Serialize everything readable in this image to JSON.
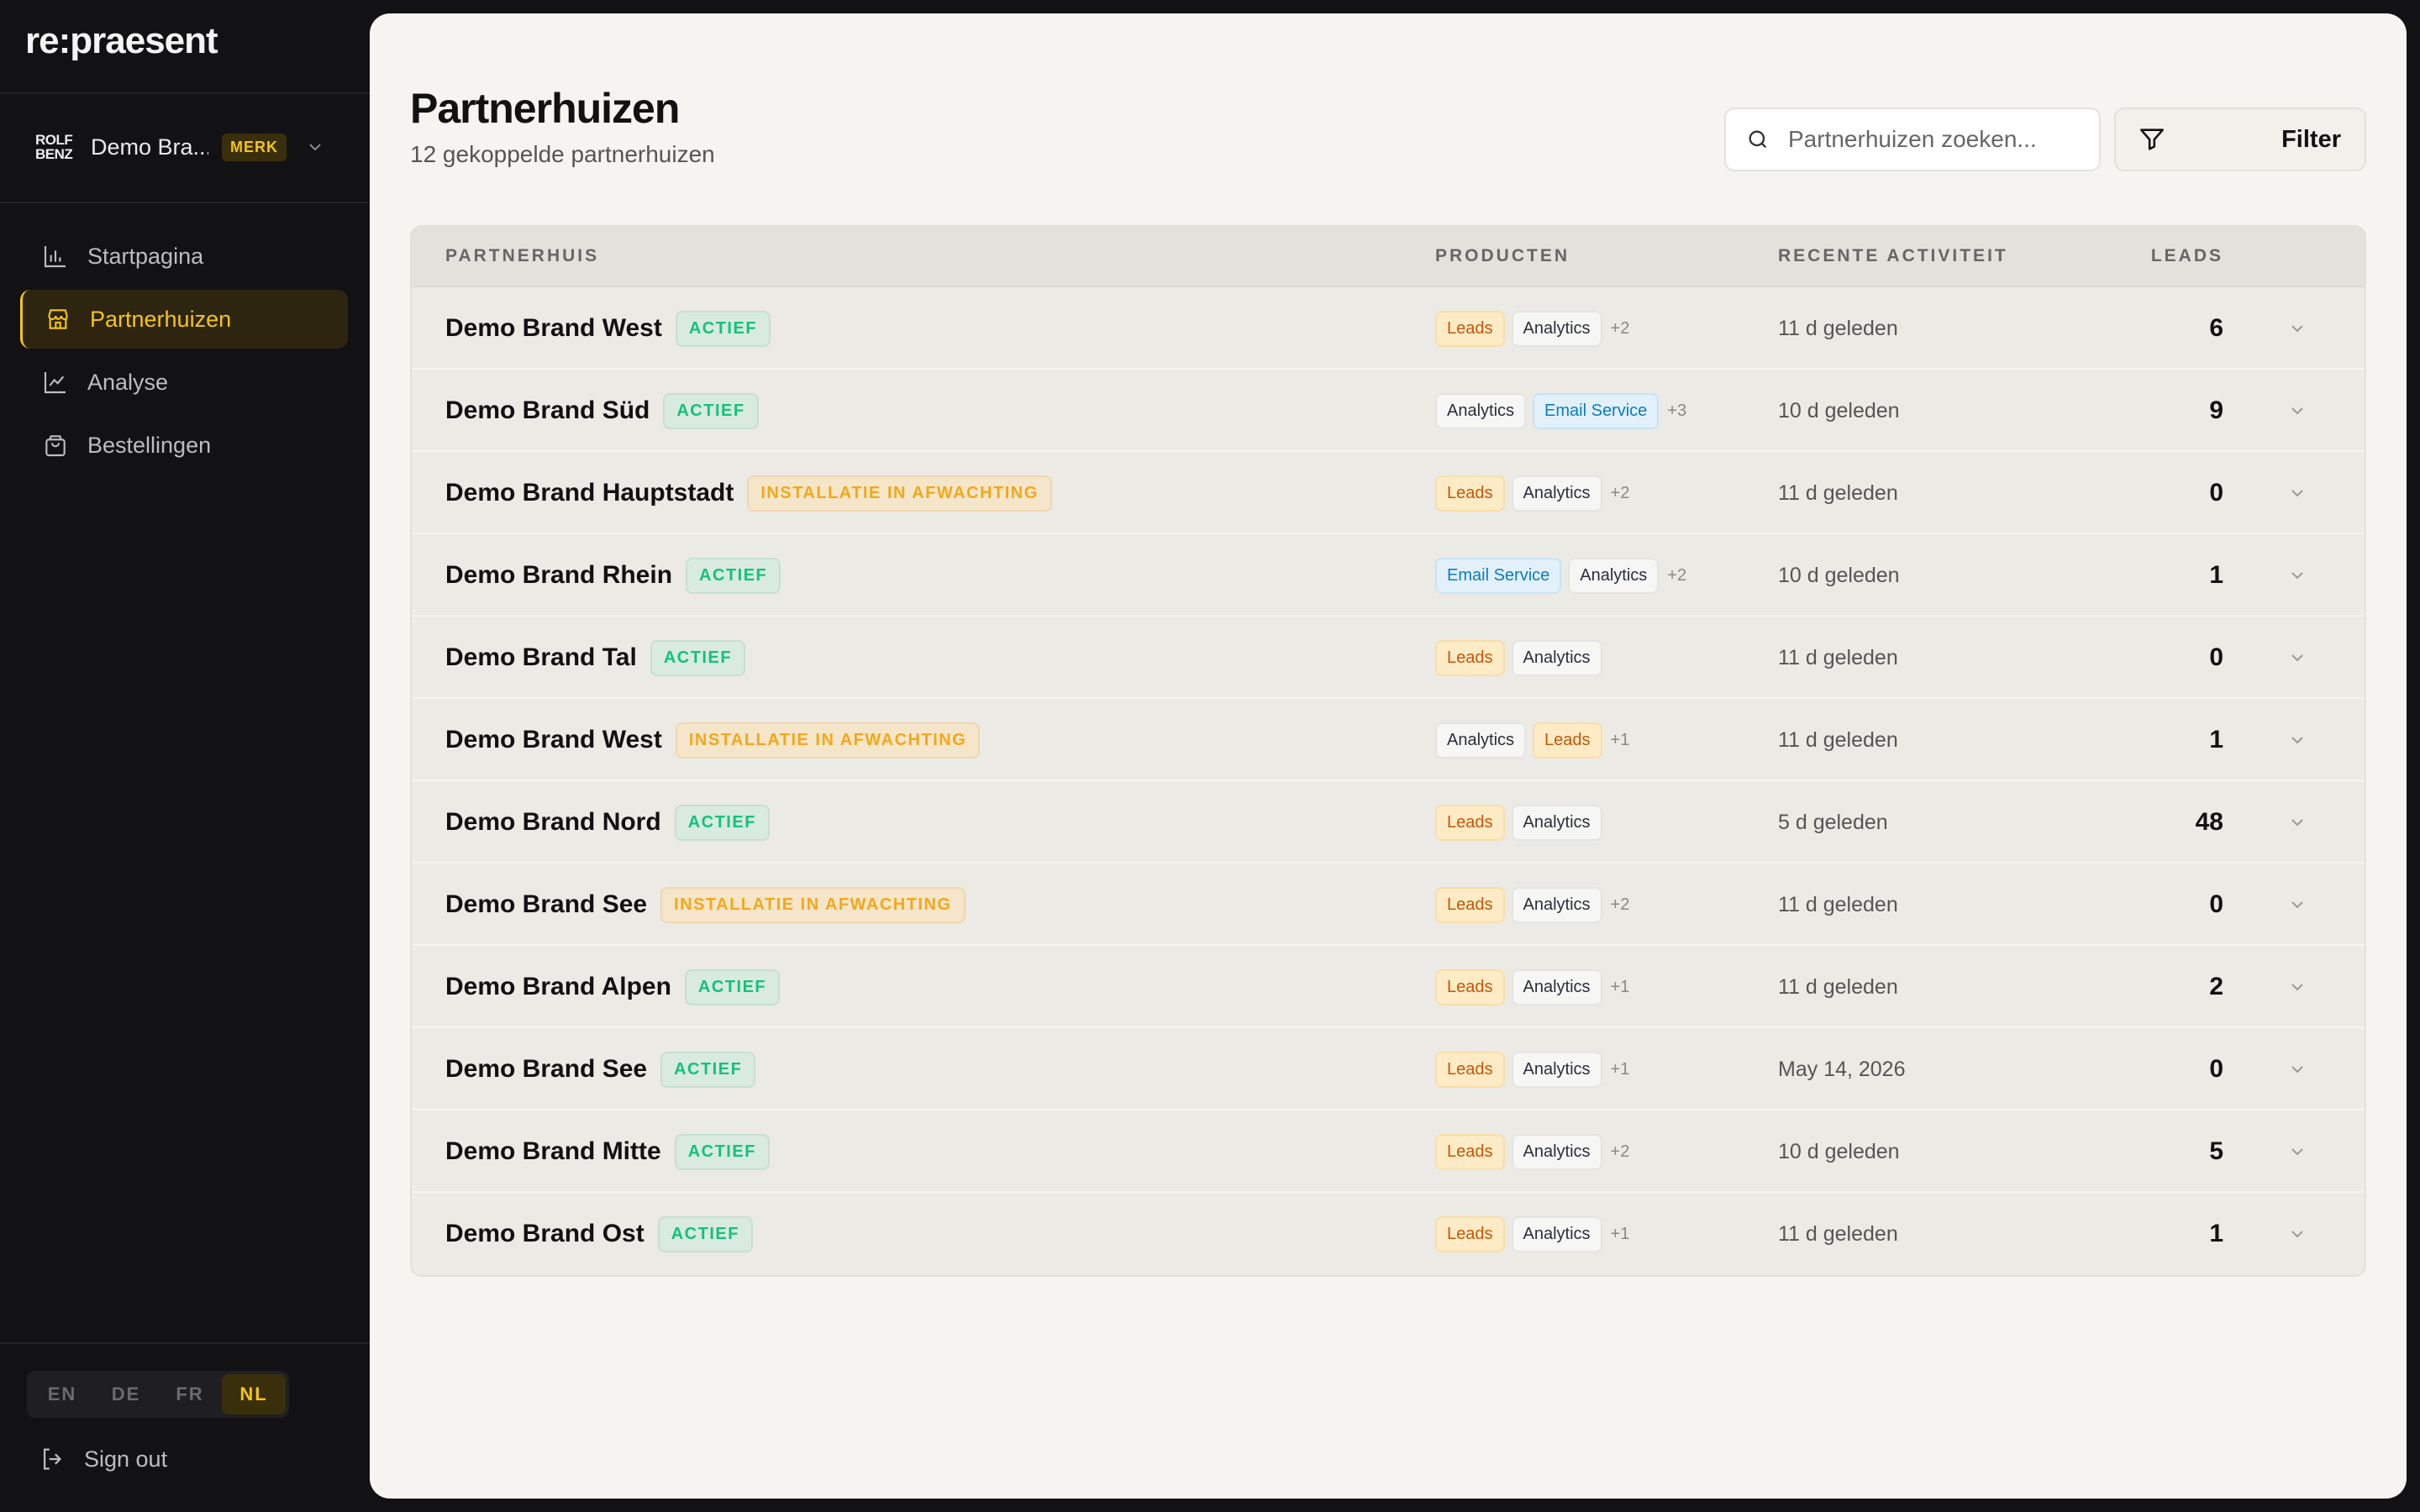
{
  "app": {
    "logo": "re:praesent"
  },
  "brand_switch": {
    "logo_line1": "ROLF",
    "logo_line2": "BENZ",
    "name": "Demo Bra...",
    "badge": "MERK"
  },
  "sidebar": {
    "items": [
      {
        "label": "Startpagina",
        "icon": "bar-chart-icon",
        "active": false
      },
      {
        "label": "Partnerhuizen",
        "icon": "store-icon",
        "active": true
      },
      {
        "label": "Analyse",
        "icon": "line-chart-icon",
        "active": false
      },
      {
        "label": "Bestellingen",
        "icon": "shopping-bag-icon",
        "active": false
      }
    ],
    "languages": [
      "EN",
      "DE",
      "FR",
      "NL"
    ],
    "active_language": "NL",
    "signout_label": "Sign out"
  },
  "main": {
    "title": "Partnerhuizen",
    "subtitle": "12 gekoppelde partnerhuizen",
    "search_placeholder": "Partnerhuizen zoeken...",
    "filter_label": "Filter"
  },
  "table": {
    "headers": {
      "partner": "PARTNERHUIS",
      "products": "PRODUCTEN",
      "activity": "RECENTE ACTIVITEIT",
      "leads": "LEADS"
    },
    "rows": [
      {
        "name": "Demo Brand West",
        "status": "ACTIEF",
        "status_type": "actief",
        "products": [
          {
            "label": "Leads",
            "type": "leads"
          },
          {
            "label": "Analytics",
            "type": "analytics"
          }
        ],
        "more": "+2",
        "activity": "11 d geleden",
        "leads": "6"
      },
      {
        "name": "Demo Brand Süd",
        "status": "ACTIEF",
        "status_type": "actief",
        "products": [
          {
            "label": "Analytics",
            "type": "analytics"
          },
          {
            "label": "Email Service",
            "type": "email"
          }
        ],
        "more": "+3",
        "activity": "10 d geleden",
        "leads": "9"
      },
      {
        "name": "Demo Brand Hauptstadt",
        "status": "INSTALLATIE IN AFWACHTING",
        "status_type": "pending",
        "products": [
          {
            "label": "Leads",
            "type": "leads"
          },
          {
            "label": "Analytics",
            "type": "analytics"
          }
        ],
        "more": "+2",
        "activity": "11 d geleden",
        "leads": "0"
      },
      {
        "name": "Demo Brand Rhein",
        "status": "ACTIEF",
        "status_type": "actief",
        "products": [
          {
            "label": "Email Service",
            "type": "email"
          },
          {
            "label": "Analytics",
            "type": "analytics"
          }
        ],
        "more": "+2",
        "activity": "10 d geleden",
        "leads": "1"
      },
      {
        "name": "Demo Brand Tal",
        "status": "ACTIEF",
        "status_type": "actief",
        "products": [
          {
            "label": "Leads",
            "type": "leads"
          },
          {
            "label": "Analytics",
            "type": "analytics"
          }
        ],
        "more": "",
        "activity": "11 d geleden",
        "leads": "0"
      },
      {
        "name": "Demo Brand West",
        "status": "INSTALLATIE IN AFWACHTING",
        "status_type": "pending",
        "products": [
          {
            "label": "Analytics",
            "type": "analytics"
          },
          {
            "label": "Leads",
            "type": "leads"
          }
        ],
        "more": "+1",
        "activity": "11 d geleden",
        "leads": "1"
      },
      {
        "name": "Demo Brand Nord",
        "status": "ACTIEF",
        "status_type": "actief",
        "products": [
          {
            "label": "Leads",
            "type": "leads"
          },
          {
            "label": "Analytics",
            "type": "analytics"
          }
        ],
        "more": "",
        "activity": "5 d geleden",
        "leads": "48"
      },
      {
        "name": "Demo Brand See",
        "status": "INSTALLATIE IN AFWACHTING",
        "status_type": "pending",
        "products": [
          {
            "label": "Leads",
            "type": "leads"
          },
          {
            "label": "Analytics",
            "type": "analytics"
          }
        ],
        "more": "+2",
        "activity": "11 d geleden",
        "leads": "0"
      },
      {
        "name": "Demo Brand Alpen",
        "status": "ACTIEF",
        "status_type": "actief",
        "products": [
          {
            "label": "Leads",
            "type": "leads"
          },
          {
            "label": "Analytics",
            "type": "analytics"
          }
        ],
        "more": "+1",
        "activity": "11 d geleden",
        "leads": "2"
      },
      {
        "name": "Demo Brand See",
        "status": "ACTIEF",
        "status_type": "actief",
        "products": [
          {
            "label": "Leads",
            "type": "leads"
          },
          {
            "label": "Analytics",
            "type": "analytics"
          }
        ],
        "more": "+1",
        "activity": "May 14, 2026",
        "leads": "0"
      },
      {
        "name": "Demo Brand Mitte",
        "status": "ACTIEF",
        "status_type": "actief",
        "products": [
          {
            "label": "Leads",
            "type": "leads"
          },
          {
            "label": "Analytics",
            "type": "analytics"
          }
        ],
        "more": "+2",
        "activity": "10 d geleden",
        "leads": "5"
      },
      {
        "name": "Demo Brand Ost",
        "status": "ACTIEF",
        "status_type": "actief",
        "products": [
          {
            "label": "Leads",
            "type": "leads"
          },
          {
            "label": "Analytics",
            "type": "analytics"
          }
        ],
        "more": "+1",
        "activity": "11 d geleden",
        "leads": "1"
      }
    ]
  },
  "colors": {
    "accent": "#f5c518",
    "sidebar_bg": "#121214",
    "main_bg": "#f5f4f0",
    "active_green": "#13c27a",
    "pending_amber": "#f2a81a"
  }
}
